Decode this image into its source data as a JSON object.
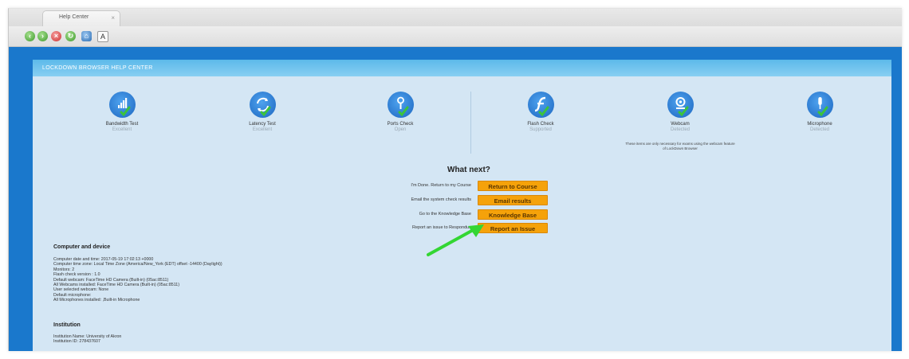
{
  "browser": {
    "tab_title": "Help Center",
    "tab_close": "×",
    "font_button_label": "A"
  },
  "panel": {
    "header_title": "LOCKDOWN BROWSER HELP CENTER"
  },
  "checks": [
    {
      "title": "Bandwidth Test",
      "status": "Excellent",
      "icon": "bandwidth-icon"
    },
    {
      "title": "Latency Test",
      "status": "Excellent",
      "icon": "latency-icon"
    },
    {
      "title": "Ports Check",
      "status": "Open",
      "icon": "ports-icon"
    },
    {
      "title": "Flash Check",
      "status": "Supported",
      "icon": "flash-icon"
    },
    {
      "title": "Webcam",
      "status": "Detected",
      "icon": "webcam-icon"
    },
    {
      "title": "Microphone",
      "status": "Detected",
      "icon": "microphone-icon"
    }
  ],
  "webcam_note": "These items are only necessary for exams using the webcam feature of LockDown Browser",
  "what_next": {
    "title": "What next?",
    "actions": [
      {
        "label": "I'm Done. Return to my Course",
        "button": "Return to Course"
      },
      {
        "label": "Email the system check results",
        "button": "Email results"
      },
      {
        "label": "Go to the Knowledge Base",
        "button": "Knowledge Base"
      },
      {
        "label": "Report an issue to Respondus",
        "button": "Report an Issue"
      }
    ]
  },
  "computer": {
    "title": "Computer and device",
    "lines": [
      "Computer date and time: 2017-05-19 17:02:13 +0000",
      "Computer time zone: Local Time Zone (America/New_York (EDT) offset -14400 (Daylight))",
      "Monitors: 2",
      "Flash check version : 1.0",
      "Default webcam: FaceTime HD Camera (Built-in) (05ac:8511)",
      "All Webcams installed: FaceTime HD Camera (Built-in) (05ac:8511)",
      "User selected webcam: None",
      "Default microphone:",
      "All Microphones installed: ,Built-in Microphone"
    ]
  },
  "institution": {
    "title": "Institution",
    "lines": [
      "Institution Name: University of Akron",
      "Institution ID: 278437607"
    ]
  },
  "colors": {
    "blue_background": "#1a78cc",
    "panel_background": "#d4e6f4",
    "button_orange": "#f5a20a",
    "check_green": "#3cc33c",
    "arrow_green": "#33d633"
  }
}
